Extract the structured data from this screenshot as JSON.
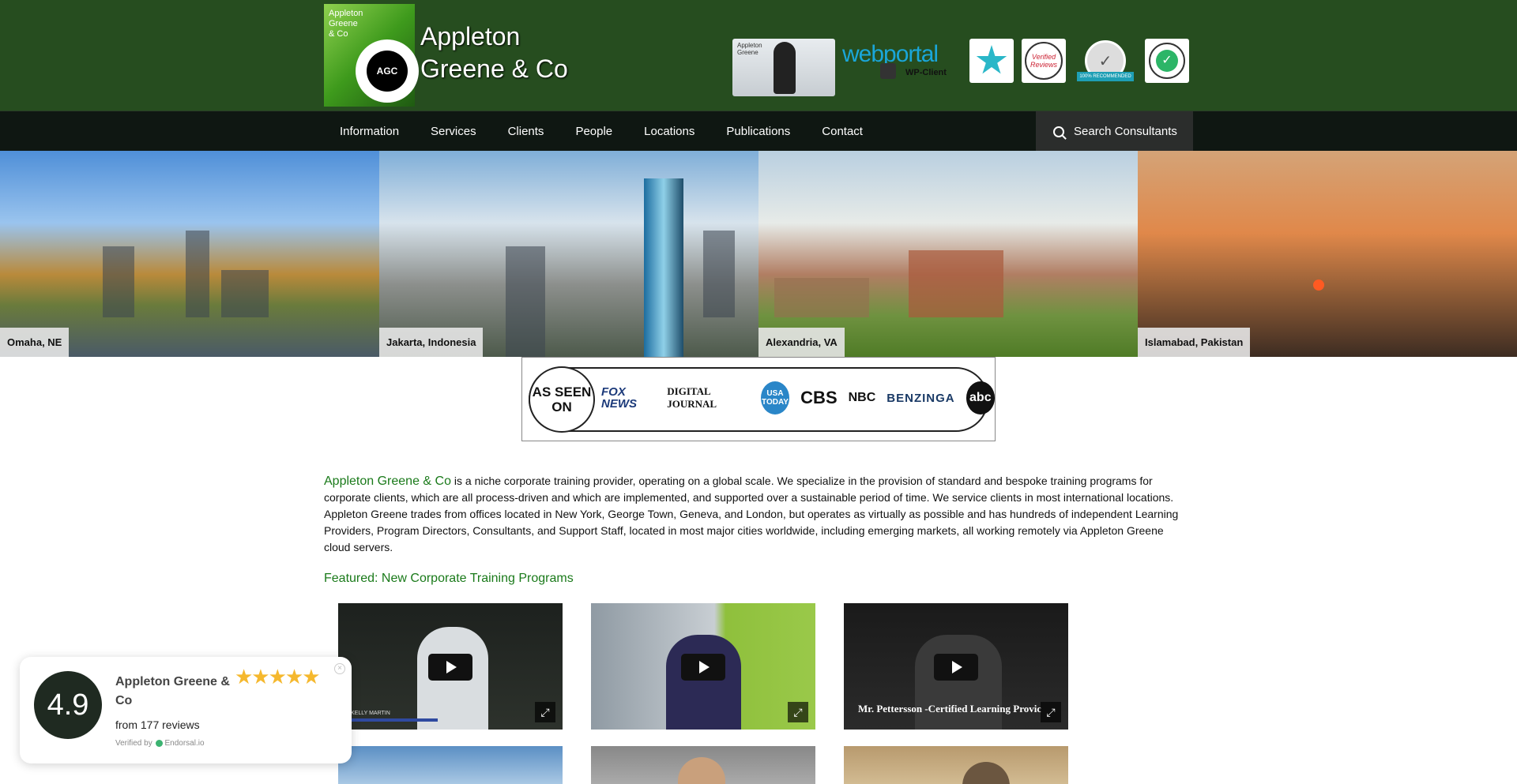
{
  "header": {
    "logo_small_text": "Appleton\nGreene\n& Co",
    "logo_monogram": "AGC",
    "brand_line1": "Appleton",
    "brand_line2": "Greene & Co",
    "badges": {
      "video_label": "Appleton\nGreene",
      "webportal_main": "webportal",
      "webportal_sub": "WP-Client",
      "verified_text": "Verified Reviews",
      "recommended_ribbon": "100% RECOMMENDED",
      "trusted_icon": "check-icon"
    }
  },
  "nav": {
    "items": [
      "Information",
      "Services",
      "Clients",
      "People",
      "Locations",
      "Publications",
      "Contact"
    ],
    "search_label": "Search Consultants"
  },
  "hero": {
    "cities": [
      "Omaha, NE",
      "Jakarta, Indonesia",
      "Alexandria, VA",
      "Islamabad, Pakistan"
    ]
  },
  "as_seen_on": {
    "label": "AS SEEN ON",
    "logos": [
      "FOX NEWS",
      "DIGITAL JOURNAL",
      "USA TODAY",
      "CBS",
      "NBC",
      "BENZINGA",
      "abc"
    ]
  },
  "intro": {
    "brand": "Appleton Greene & Co",
    "text": " is a niche corporate training provider, operating on a global scale. We specialize in the provision of standard and bespoke training programs for corporate clients, which are all process-driven and which are implemented, and supported over a sustainable period of time. We service clients in most international locations. Appleton Greene trades from offices located in New York, George Town, Geneva, and London, but operates as virtually as possible and has hundreds of independent Learning Providers, Program Directors, Consultants, and Support Staff, located in most major cities worldwide, including emerging markets, all working remotely via Appleton Greene cloud servers."
  },
  "featured": {
    "heading": "Featured: New Corporate Training Programs",
    "videos": [
      {
        "caption": "KELLY MARTIN"
      },
      {
        "caption": ""
      },
      {
        "caption": "Mr. Pettersson -Certified Learning Provic"
      }
    ]
  },
  "review": {
    "score": "4.9",
    "name": "Appleton Greene & Co",
    "stars": "★★★★★",
    "count": "from 177 reviews",
    "verified_prefix": "Verified by",
    "verified_by": "Endorsal.io",
    "close": "×"
  },
  "colors": {
    "header_bg": "#264d1f",
    "nav_bg": "#0f1712",
    "brand_green": "#1a7a1a",
    "star_gold": "#f5b82e"
  }
}
